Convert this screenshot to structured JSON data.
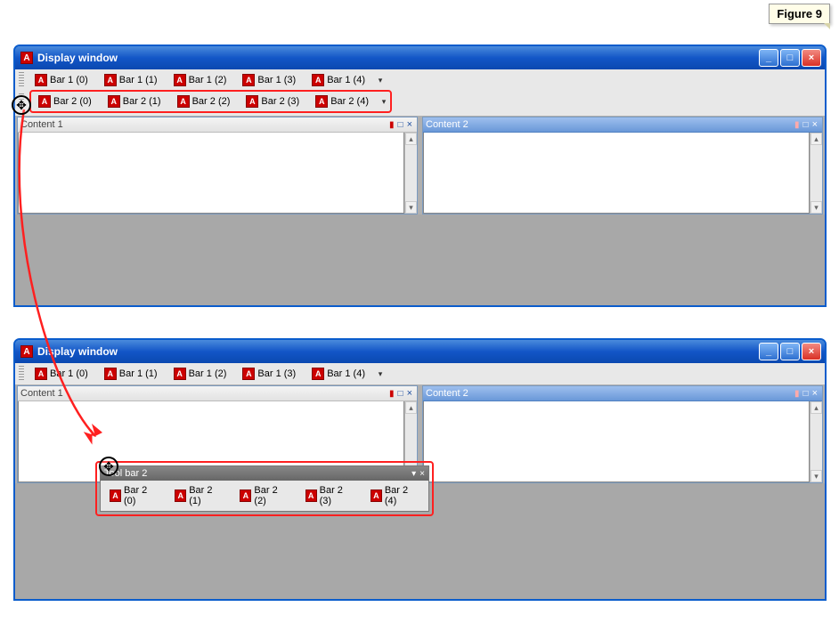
{
  "figure_label": "Figure 9",
  "window_title": "Display window",
  "app_icon_letter": "A",
  "toolbar1": {
    "items": [
      {
        "label": "Bar 1 (0)"
      },
      {
        "label": "Bar 1 (1)"
      },
      {
        "label": "Bar 1 (2)"
      },
      {
        "label": "Bar 1 (3)"
      },
      {
        "label": "Bar 1 (4)"
      }
    ]
  },
  "toolbar2": {
    "items": [
      {
        "label": "Bar 2 (0)"
      },
      {
        "label": "Bar 2 (1)"
      },
      {
        "label": "Bar 2 (2)"
      },
      {
        "label": "Bar 2 (3)"
      },
      {
        "label": "Bar 2 (4)"
      }
    ]
  },
  "panes": {
    "left_title": "Content 1",
    "right_title": "Content 2"
  },
  "floating_toolbar_title": "Tool bar 2",
  "icons": {
    "minimize": "_",
    "maximize": "□",
    "close": "×",
    "pin": "📌",
    "dropdown": "▾"
  }
}
